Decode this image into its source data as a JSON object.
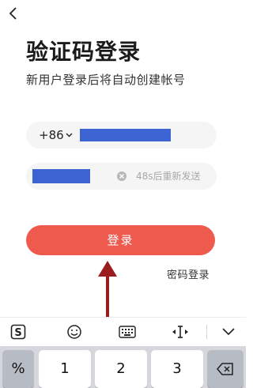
{
  "header": {
    "back_icon": "chevron-left-icon"
  },
  "title": "验证码登录",
  "subtitle": "新用户登录后将自动创建帐号",
  "phone_field": {
    "country_code": "+86"
  },
  "code_field": {
    "resend_text": "48s后重新发送"
  },
  "login_button": {
    "label": "登录"
  },
  "password_login_link": {
    "label": "密码登录"
  },
  "colors": {
    "accent": "#ef5a4f",
    "redaction": "#3d64d3",
    "annotation_arrow": "#9b1c1c"
  },
  "keyboard_toolbar": {
    "icons": [
      "sogou-logo-icon",
      "emoji-icon",
      "keyboard-icon",
      "cursor-move-icon",
      "collapse-chevron-icon"
    ]
  },
  "keyboard": {
    "keys": [
      "%",
      "1",
      "2",
      "3"
    ],
    "backspace_icon": "backspace-icon"
  }
}
